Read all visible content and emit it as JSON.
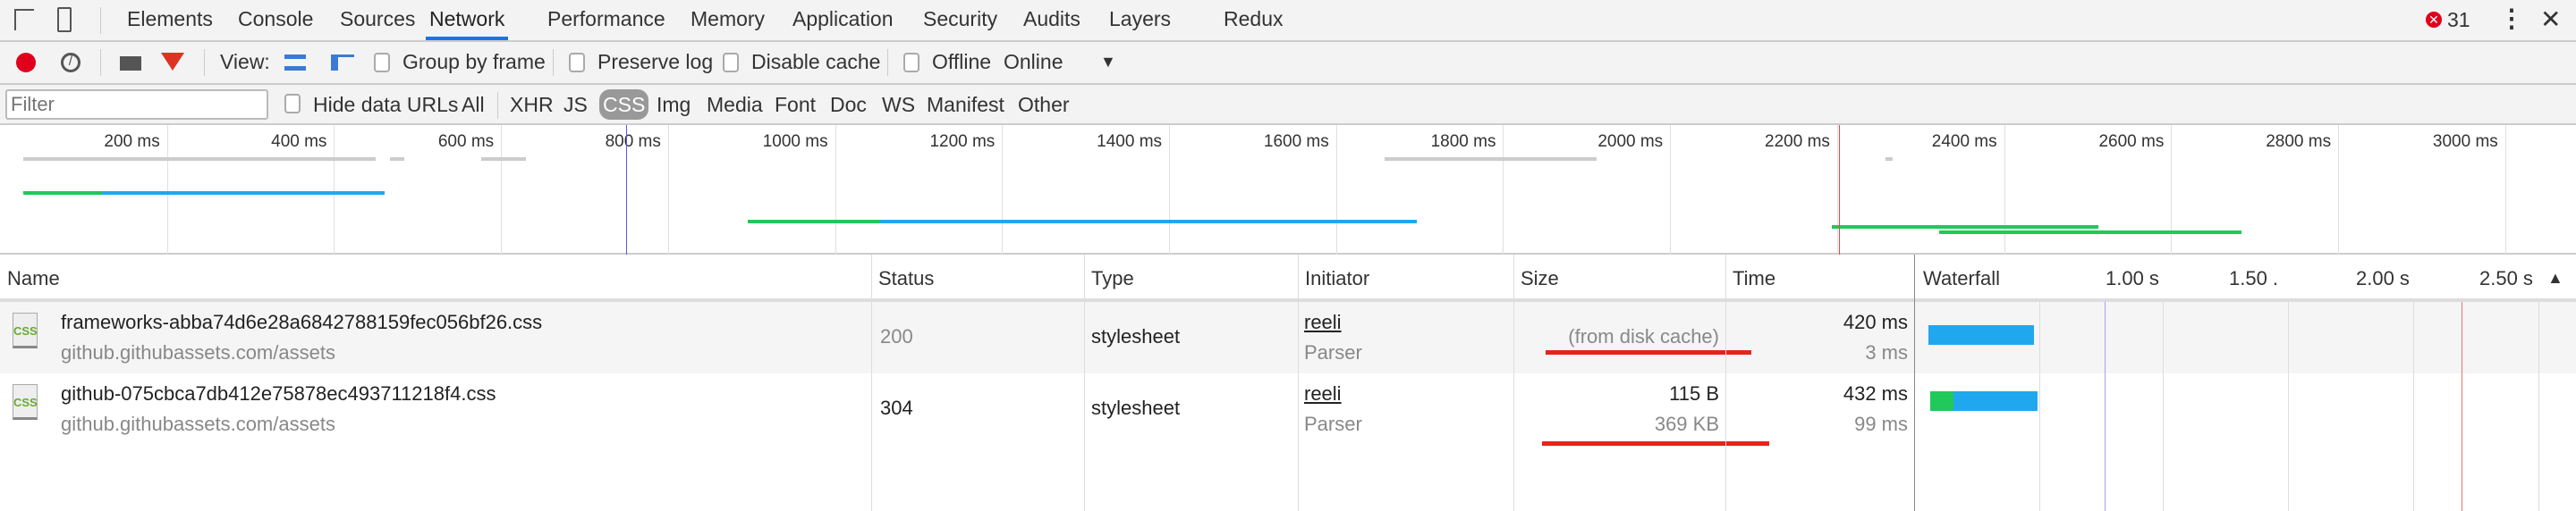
{
  "tabs": [
    "Elements",
    "Console",
    "Sources",
    "Network",
    "Performance",
    "Memory",
    "Application",
    "Security",
    "Audits",
    "Layers",
    "Redux"
  ],
  "active_tab": "Network",
  "error_count": "31",
  "toolbar": {
    "view_label": "View:",
    "group_by_frame": "Group by frame",
    "preserve_log": "Preserve log",
    "disable_cache": "Disable cache",
    "offline": "Offline",
    "throttle": "Online"
  },
  "filter": {
    "placeholder": "Filter",
    "hide_data_urls": "Hide data URLs",
    "types": [
      "All",
      "XHR",
      "JS",
      "CSS",
      "Img",
      "Media",
      "Font",
      "Doc",
      "WS",
      "Manifest",
      "Other"
    ],
    "selected": "CSS"
  },
  "overview": {
    "ticks": [
      "200 ms",
      "400 ms",
      "600 ms",
      "800 ms",
      "1000 ms",
      "1200 ms",
      "1400 ms",
      "1600 ms",
      "1800 ms",
      "2000 ms",
      "2200 ms",
      "2400 ms",
      "2600 ms",
      "2800 ms",
      "3000 ms"
    ],
    "dom_content_loaded_ms": 750,
    "load_ms": 2200
  },
  "columns": [
    "Name",
    "Status",
    "Type",
    "Initiator",
    "Size",
    "Time",
    "Waterfall"
  ],
  "waterfall_ticks": [
    "1.00 s",
    "1.50 .",
    "2.00 s",
    "2.50 s"
  ],
  "rows": [
    {
      "name": "frameworks-abba74d6e28a6842788159fec056bf26.css",
      "domain": "github.githubassets.com/assets",
      "status": "200",
      "type": "stylesheet",
      "initiator": "reeli",
      "initiator_type": "Parser",
      "size": "(from disk cache)",
      "size2": "",
      "time": "420 ms",
      "latency": "3 ms"
    },
    {
      "name": "github-075cbca7db412e75878ec493711218f4.css",
      "domain": "github.githubassets.com/assets",
      "status": "304",
      "type": "stylesheet",
      "initiator": "reeli",
      "initiator_type": "Parser",
      "size": "115 B",
      "size2": "369 KB",
      "time": "432 ms",
      "latency": "99 ms"
    }
  ],
  "colors": {
    "accent": "#1a73e8",
    "waiting": "#1fc95a",
    "download": "#1fa8ee",
    "record": "#e0001b",
    "annotation": "#e8231b"
  }
}
